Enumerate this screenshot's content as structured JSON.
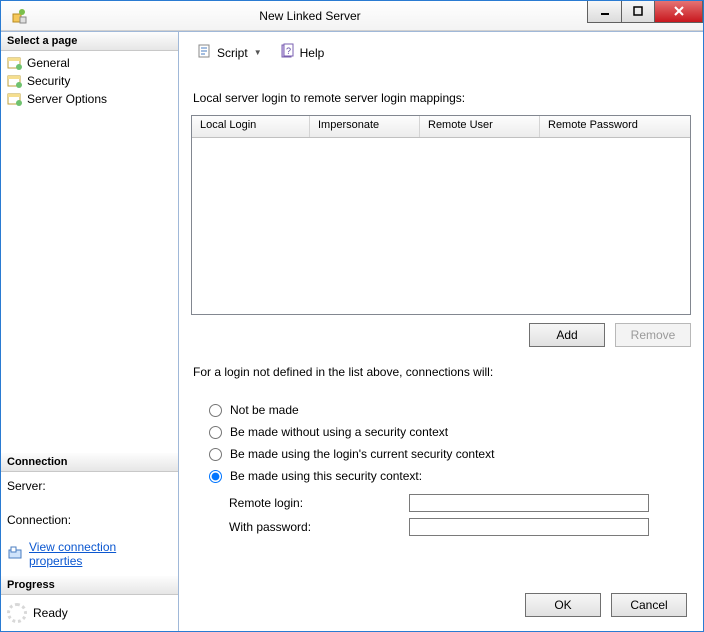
{
  "window": {
    "title": "New Linked Server"
  },
  "sidebar": {
    "select_page_header": "Select a page",
    "pages": [
      {
        "label": "General"
      },
      {
        "label": "Security"
      },
      {
        "label": "Server Options"
      }
    ],
    "connection_header": "Connection",
    "server_label": "Server:",
    "server_value": "",
    "connection_label": "Connection:",
    "connection_value": "",
    "view_props_link": "View connection properties",
    "progress_header": "Progress",
    "progress_status": "Ready"
  },
  "toolbar": {
    "script_label": "Script",
    "help_label": "Help"
  },
  "main": {
    "mappings_label": "Local server login to remote server login mappings:",
    "columns": [
      "Local Login",
      "Impersonate",
      "Remote User",
      "Remote Password"
    ],
    "add_label": "Add",
    "remove_label": "Remove",
    "not_defined_label": "For a login not defined in the list above, connections will:",
    "radio_not_made": "Not be made",
    "radio_without_ctx": "Be made without using a security context",
    "radio_current_ctx": "Be made using the login's current security context",
    "radio_this_ctx": "Be made using this security context:",
    "selected_radio": "this_ctx",
    "remote_login_label": "Remote login:",
    "remote_login_value": "",
    "with_password_label": "With password:",
    "with_password_value": ""
  },
  "footer": {
    "ok_label": "OK",
    "cancel_label": "Cancel"
  }
}
